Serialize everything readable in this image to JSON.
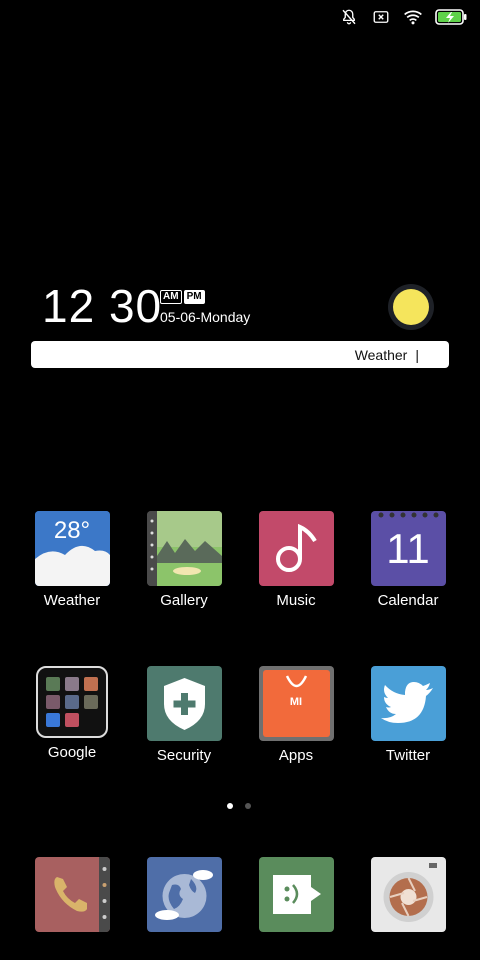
{
  "status_bar": {
    "icons": [
      "notifications-off-icon",
      "no-sim-icon",
      "wifi-icon",
      "battery-charging-icon"
    ]
  },
  "clock_widget": {
    "time": "12 30",
    "am_label": "AM",
    "pm_label": "PM",
    "date": "05-06-Monday",
    "weather_icon": "sun-icon"
  },
  "search_bar": {
    "text": "Weather",
    "cursor": "|"
  },
  "apps_row1": [
    {
      "label": "Weather",
      "temperature": "28°"
    },
    {
      "label": "Gallery"
    },
    {
      "label": "Music"
    },
    {
      "label": "Calendar",
      "date": "11"
    }
  ],
  "apps_row2": [
    {
      "label": "Google"
    },
    {
      "label": "Security"
    },
    {
      "label": "Apps",
      "brand": "MI"
    },
    {
      "label": "Twitter"
    }
  ],
  "page_indicator": {
    "count": 2,
    "active": 0
  },
  "dock": {
    "apps": [
      "phone",
      "browser",
      "messaging",
      "camera"
    ]
  },
  "colors": {
    "background": "#000000",
    "weather_sky": "#3c78c8",
    "gallery_bg": "#8cc46a",
    "music_bg": "#c24a6a",
    "calendar_bg": "#5b4fa6",
    "security_bg": "#4e7a6e",
    "apps_bg": "#f26a3b",
    "twitter_bg": "#4a9fd7",
    "phone_bg": "#a86060",
    "browser_bg": "#4f6ea8",
    "messaging_bg": "#5a8c5c",
    "camera_bg": "#e8e8e8",
    "sun": "#f5e55c"
  }
}
